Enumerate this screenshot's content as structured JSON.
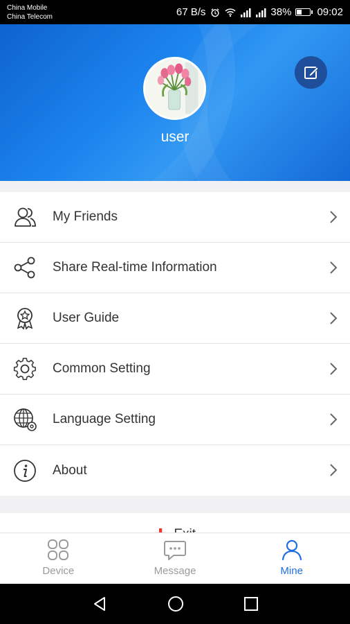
{
  "status_bar": {
    "carrier_1": "China Mobile",
    "carrier_2": "China Telecom",
    "net_speed": "67 B/s",
    "battery": "38%",
    "battery_level": 0.38,
    "time": "09:02"
  },
  "profile": {
    "username": "user"
  },
  "menu": {
    "items": [
      {
        "label": "My Friends",
        "icon": "friends-icon"
      },
      {
        "label": "Share Real-time Information",
        "icon": "share-icon"
      },
      {
        "label": "User Guide",
        "icon": "award-icon"
      },
      {
        "label": "Common Setting",
        "icon": "gear-icon"
      },
      {
        "label": "Language Setting",
        "icon": "globe-gear-icon"
      },
      {
        "label": "About",
        "icon": "info-icon"
      }
    ]
  },
  "exit": {
    "label": "Exit"
  },
  "tabs": [
    {
      "label": "Device",
      "icon": "grid-icon",
      "active": false
    },
    {
      "label": "Message",
      "icon": "chat-icon",
      "active": false
    },
    {
      "label": "Mine",
      "icon": "person-icon",
      "active": true
    }
  ],
  "colors": {
    "accent": "#1f6fe0",
    "header_blue": "#1c84ee",
    "exit_red": "#e53935"
  }
}
